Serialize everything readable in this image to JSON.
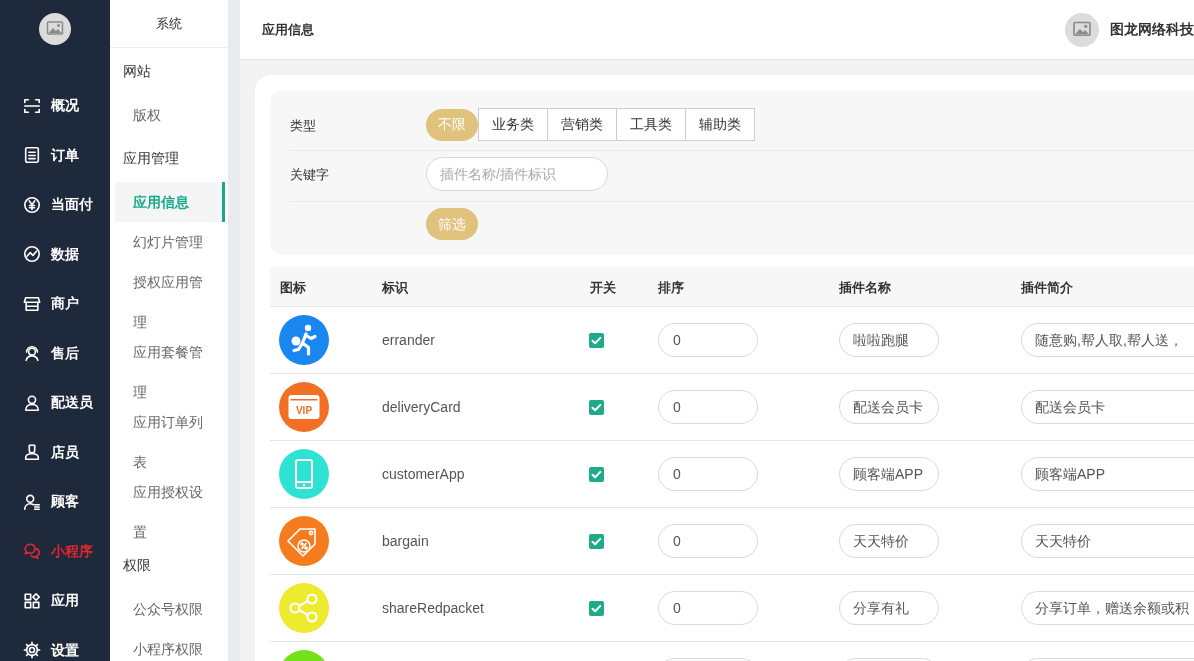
{
  "sidebar": {
    "items": [
      {
        "label": "概况",
        "selected": false
      },
      {
        "label": "订单",
        "selected": false
      },
      {
        "label": "当面付",
        "selected": false
      },
      {
        "label": "数据",
        "selected": false
      },
      {
        "label": "商户",
        "selected": false
      },
      {
        "label": "售后",
        "selected": false
      },
      {
        "label": "配送员",
        "selected": false
      },
      {
        "label": "店员",
        "selected": false
      },
      {
        "label": "顾客",
        "selected": false
      },
      {
        "label": "小程序",
        "selected": true
      },
      {
        "label": "应用",
        "selected": false
      },
      {
        "label": "设置",
        "selected": false
      }
    ]
  },
  "subnav": {
    "title": "系统",
    "groups": [
      {
        "label": "网站",
        "items": [
          {
            "label": "版权",
            "selected": false
          }
        ]
      },
      {
        "label": "应用管理",
        "items": [
          {
            "label": "应用信息",
            "selected": true
          },
          {
            "label": "幻灯片管理",
            "selected": false
          },
          {
            "label": "授权应用管理",
            "selected": false
          },
          {
            "label": "应用套餐管理",
            "selected": false
          },
          {
            "label": "应用订单列表",
            "selected": false
          },
          {
            "label": "应用授权设置",
            "selected": false
          }
        ]
      },
      {
        "label": "权限",
        "items": [
          {
            "label": "公众号权限",
            "selected": false
          },
          {
            "label": "小程序权限",
            "selected": false
          }
        ]
      }
    ]
  },
  "header": {
    "title": "应用信息",
    "user_name": "图龙网络科技"
  },
  "filter": {
    "type": {
      "label": "类型",
      "options": [
        {
          "label": "不限",
          "selected": true
        },
        {
          "label": "业务类",
          "selected": false
        },
        {
          "label": "营销类",
          "selected": false
        },
        {
          "label": "工具类",
          "selected": false
        },
        {
          "label": "辅助类",
          "selected": false
        }
      ]
    },
    "keyword": {
      "label": "关键字",
      "placeholder": "插件名称/插件标识"
    },
    "button": "筛选"
  },
  "table": {
    "columns": [
      "图标",
      "标识",
      "开关",
      "排序",
      "插件名称",
      "插件简介"
    ],
    "rows": [
      {
        "key": "errander",
        "enabled": true,
        "sort": "0",
        "name": "啦啦跑腿",
        "intro": "随意购,帮人取,帮人送，"
      },
      {
        "icon_text": "VIP",
        "key": "deliveryCard",
        "enabled": true,
        "sort": "0",
        "name": "配送会员卡",
        "intro": "配送会员卡"
      },
      {
        "key": "customerApp",
        "enabled": true,
        "sort": "0",
        "name": "顾客端APP",
        "intro": "顾客端APP"
      },
      {
        "key": "bargain",
        "enabled": true,
        "sort": "0",
        "name": "天天特价",
        "intro": "天天特价"
      },
      {
        "key": "shareRedpacket",
        "enabled": true,
        "sort": "0",
        "name": "分享有礼",
        "intro": "分享订单，赠送余额或积"
      },
      {}
    ]
  }
}
